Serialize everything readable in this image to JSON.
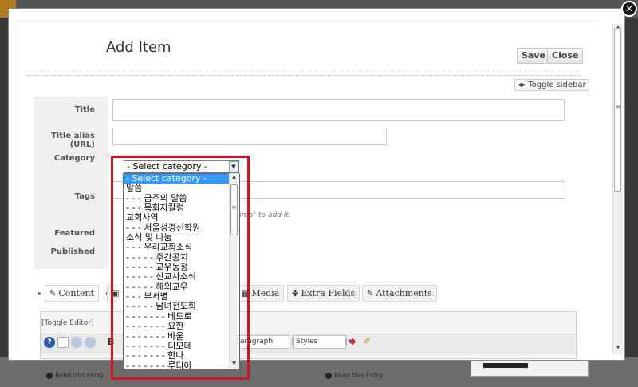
{
  "page": {
    "title": "Add Item",
    "save_label": "Save",
    "close_label": "Close",
    "toggle_sidebar": "Toggle sidebar",
    "modal_close_glyph": "✕"
  },
  "form": {
    "title_label": "Title",
    "alias_label": "Title alias (URL)",
    "category_label": "Category",
    "tags_label": "Tags",
    "tags_hint": "mma\" to add it.",
    "featured_label": "Featured",
    "published_label": "Published"
  },
  "category": {
    "selected": "- Select category -",
    "options": [
      "- Select category -",
      "말씀",
      "- - - 금주의 말씀",
      "- - - 목회자칼럼",
      "교회사역",
      "- - - 서울성경신학원",
      "소식 및 나눔",
      "- - - 우리교회소식",
      "- - - - - 주간공지",
      "- - - - - 교우동정",
      "- - - - - 선교사소식",
      "- - - - - 해외교우",
      "- - - 부서별",
      "- - - - - 남녀전도회",
      "- - - - - - - 베드로",
      "- - - - - - - 요한",
      "- - - - - - - 바울",
      "- - - - - - - 디모데",
      "- - - - - - - 한나",
      "- - - - - - - 루디아"
    ]
  },
  "tabs": {
    "content": "Content",
    "media": "Media",
    "extra_fields": "Extra Fields",
    "attachments": "Attachments"
  },
  "editor": {
    "toggle": "[Toggle Editor]",
    "bold": "B",
    "paragraph": "Paragraph",
    "styles": "Styles",
    "help": "?"
  },
  "background": {
    "read_entry": "Read this Entry"
  },
  "colors": {
    "highlight": "#d0161c",
    "selected": "#3399ff"
  }
}
